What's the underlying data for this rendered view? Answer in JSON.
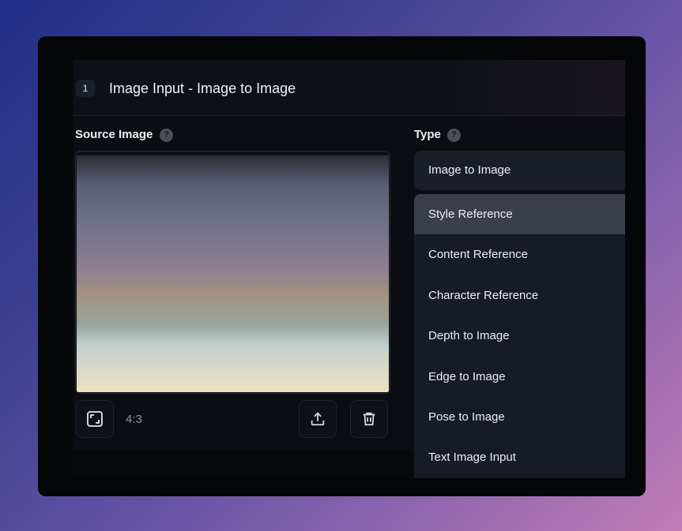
{
  "header": {
    "step_number": "1",
    "title": "Image Input - Image to Image"
  },
  "source_image": {
    "label": "Source Image",
    "help_icon": "question-mark-icon",
    "aspect_ratio": "4:3",
    "controls": {
      "crop_icon": "crop-icon",
      "upload_icon": "upload-icon",
      "delete_icon": "trash-icon"
    }
  },
  "type": {
    "label": "Type",
    "help_icon": "question-mark-icon",
    "selected": "Image to Image",
    "options": [
      "Style Reference",
      "Content Reference",
      "Character Reference",
      "Depth to Image",
      "Edge to Image",
      "Pose to Image",
      "Text Image Input"
    ],
    "highlighted_index": 0
  },
  "colors": {
    "panel": "#0b0d12",
    "dropdown": "#171b27",
    "highlight": "#3b3f49",
    "text": "#eceef3"
  }
}
